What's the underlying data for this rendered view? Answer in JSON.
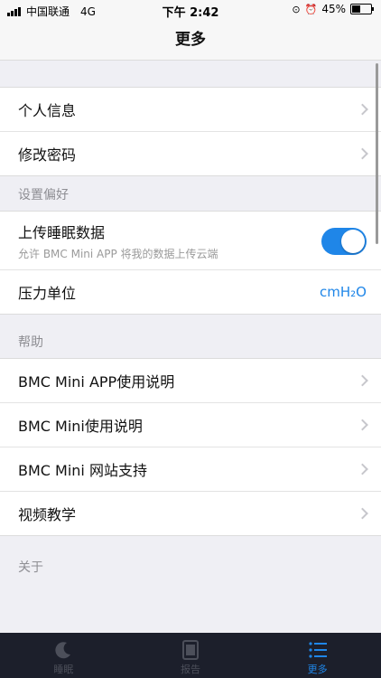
{
  "status_bar": {
    "carrier": "中国联通",
    "network": "4G",
    "time": "下午 2:42",
    "battery": "45%"
  },
  "nav": {
    "title": "更多"
  },
  "account": {
    "items": [
      {
        "label": "个人信息"
      },
      {
        "label": "修改密码"
      }
    ]
  },
  "preferences": {
    "header": "设置偏好",
    "upload": {
      "label": "上传睡眠数据",
      "subtitle": "允许 BMC Mini APP 将我的数据上传云端",
      "enabled": true
    },
    "pressure": {
      "label": "压力单位",
      "value": "cmH₂O"
    }
  },
  "help": {
    "header": "帮助",
    "items": [
      {
        "label": "BMC Mini APP使用说明"
      },
      {
        "label": "BMC Mini使用说明"
      },
      {
        "label": "BMC Mini 网站支持"
      },
      {
        "label": "视频教学"
      }
    ]
  },
  "about": {
    "header": "关于"
  },
  "tabbar": {
    "tabs": [
      {
        "label": "睡眠",
        "icon": "moon-icon"
      },
      {
        "label": "报告",
        "icon": "report-icon"
      },
      {
        "label": "更多",
        "icon": "list-icon",
        "active": true
      }
    ]
  },
  "colors": {
    "accent": "#1f86e8",
    "tabbar_bg": "#1c1f2b",
    "background": "#efeff4"
  }
}
